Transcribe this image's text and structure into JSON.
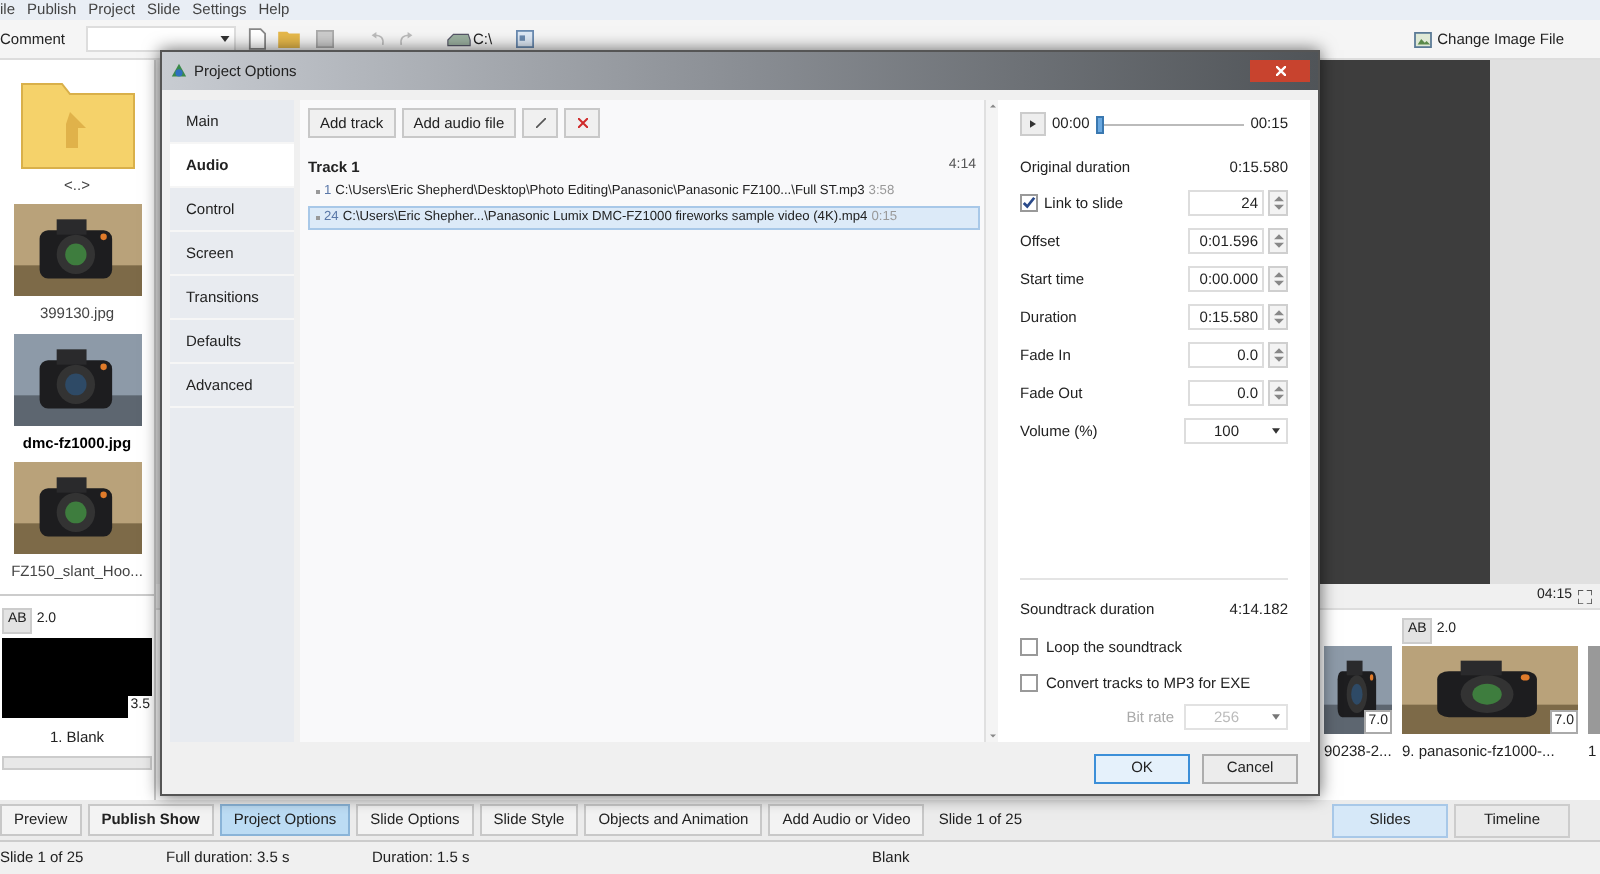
{
  "menu_bar": [
    "ile",
    "Publish",
    "Project",
    "Slide",
    "Settings",
    "Help"
  ],
  "toolbar": {
    "comment_label": "Comment",
    "drive_label": "C:\\",
    "change_image": "Change Image File"
  },
  "file_list": [
    {
      "kind": "folder",
      "label": "<..>",
      "selected": false
    },
    {
      "kind": "picture",
      "label": "399130.jpg",
      "selected": false
    },
    {
      "kind": "picture",
      "label": "dmc-fz1000.jpg",
      "selected": true
    },
    {
      "kind": "picture",
      "label": "FZ150_slant_Hoo...",
      "selected": false
    }
  ],
  "slide_panel": {
    "transition": "AB",
    "transition_time": "2.0",
    "duration": "3.5",
    "label": "1. Blank"
  },
  "preview": {
    "time": "04:15"
  },
  "slides_strip": [
    {
      "duration": "7.0",
      "label": "90238-2..."
    },
    {
      "transition": "AB",
      "transition_time": "2.0",
      "duration": "7.0",
      "label": "9. panasonic-fz1000-..."
    },
    {
      "label": "1"
    }
  ],
  "bottom_buttons": [
    {
      "label": "Preview",
      "selected": false
    },
    {
      "label": "Publish Show",
      "selected": false
    },
    {
      "label": "Project Options",
      "selected": true
    },
    {
      "label": "Slide Options",
      "selected": false
    },
    {
      "label": "Slide Style",
      "selected": false
    },
    {
      "label": "Objects and Animation",
      "selected": false
    },
    {
      "label": "Add Audio or Video",
      "selected": false
    }
  ],
  "slide_counter": "Slide 1 of 25",
  "view_tabs": [
    {
      "label": "Slides",
      "selected": true
    },
    {
      "label": "Timeline",
      "selected": false
    }
  ],
  "status_bar": [
    "Slide 1 of 25",
    "Full duration: 3.5 s",
    "Duration: 1.5 s",
    "Blank"
  ],
  "dialog": {
    "title": "Project Options",
    "nav": [
      {
        "label": "Main",
        "selected": false
      },
      {
        "label": "Audio",
        "selected": true
      },
      {
        "label": "Control",
        "selected": false
      },
      {
        "label": "Screen",
        "selected": false
      },
      {
        "label": "Transitions",
        "selected": false
      },
      {
        "label": "Defaults",
        "selected": false
      },
      {
        "label": "Advanced",
        "selected": false
      }
    ],
    "toolbar": [
      "Add track",
      "Add audio file"
    ],
    "track": {
      "title": "Track 1",
      "length": "4:14",
      "files": [
        {
          "number": "1",
          "path": "C:\\Users\\Eric Shepherd\\Desktop\\Photo Editing\\Panasonic\\Panasonic FZ100...\\Full ST.mp3",
          "length": "3:58",
          "selected": false
        },
        {
          "number": "24",
          "path": "C:\\Users\\Eric Shepher...\\Panasonic Lumix DMC-FZ1000 fireworks sample video (4K).mp4",
          "length": "0:15",
          "selected": true
        }
      ]
    },
    "player": {
      "start": "00:00",
      "end": "00:15",
      "level": 0
    },
    "original_duration": {
      "label": "Original duration",
      "value": "0:15.580"
    },
    "fields": [
      {
        "kind": "check",
        "label": "Link to slide",
        "checked": true,
        "value": "24"
      },
      {
        "kind": "spin",
        "label": "Offset",
        "value": "0:01.596"
      },
      {
        "kind": "spin",
        "label": "Start time",
        "value": "0:00.000"
      },
      {
        "kind": "spin",
        "label": "Duration",
        "value": "0:15.580"
      },
      {
        "kind": "spin",
        "label": "Fade In",
        "value": "0.0"
      },
      {
        "kind": "spin",
        "label": "Fade Out",
        "value": "0.0"
      },
      {
        "kind": "dropdown",
        "label": "Volume (%)",
        "value": "100"
      }
    ],
    "soundtrack_duration": {
      "label": "Soundtrack duration",
      "value": "4:14.182"
    },
    "options": [
      {
        "label": "Loop the soundtrack",
        "checked": false
      },
      {
        "label": "Convert tracks to MP3 for EXE",
        "checked": false
      }
    ],
    "bit_rate": {
      "label": "Bit rate",
      "value": "256",
      "disabled": true
    },
    "buttons": [
      {
        "label": "OK",
        "selected": true
      },
      {
        "label": "Cancel",
        "selected": false
      }
    ]
  }
}
